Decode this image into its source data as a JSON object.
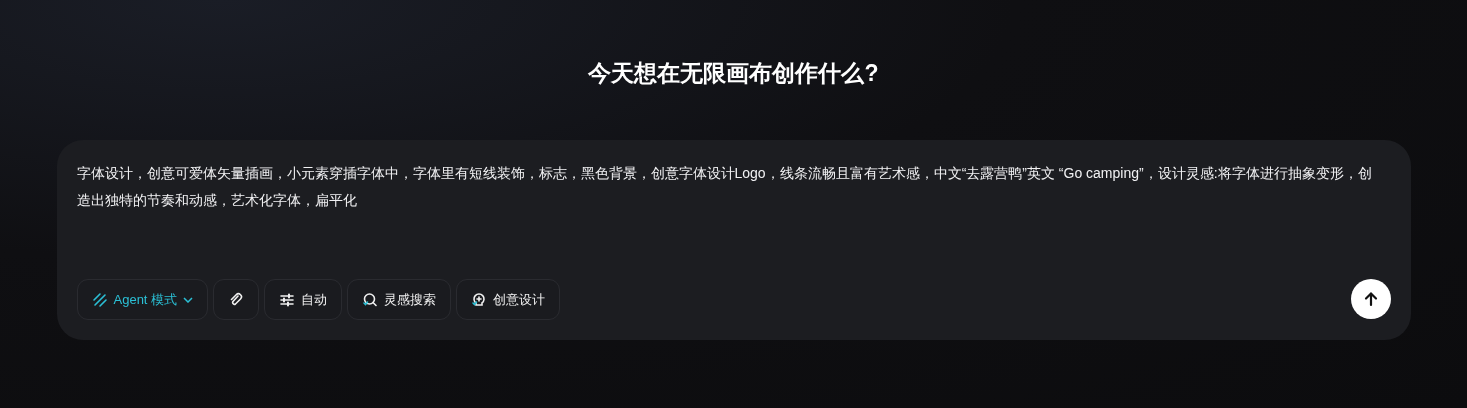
{
  "heading": "今天想在无限画布创作什么?",
  "prompt": {
    "value": "字体设计，创意可爱体矢量插画，小元素穿插字体中，字体里有短线装饰，标志，黑色背景，创意字体设计Logo，线条流畅且富有艺术感，中文“去露营鸭”英文 “Go camping”，设计灵感:将字体进行抽象变形，创造出独特的节奏和动感，艺术化字体，扁平化"
  },
  "tools": [
    {
      "kind": "mode",
      "label": "Agent 模式",
      "selected": true
    },
    {
      "kind": "attach",
      "selected": false
    },
    {
      "kind": "auto",
      "label": "自动",
      "selected": false
    },
    {
      "kind": "search",
      "label": "灵感搜索",
      "selected": false
    },
    {
      "kind": "design",
      "label": "创意设计",
      "selected": false
    }
  ]
}
